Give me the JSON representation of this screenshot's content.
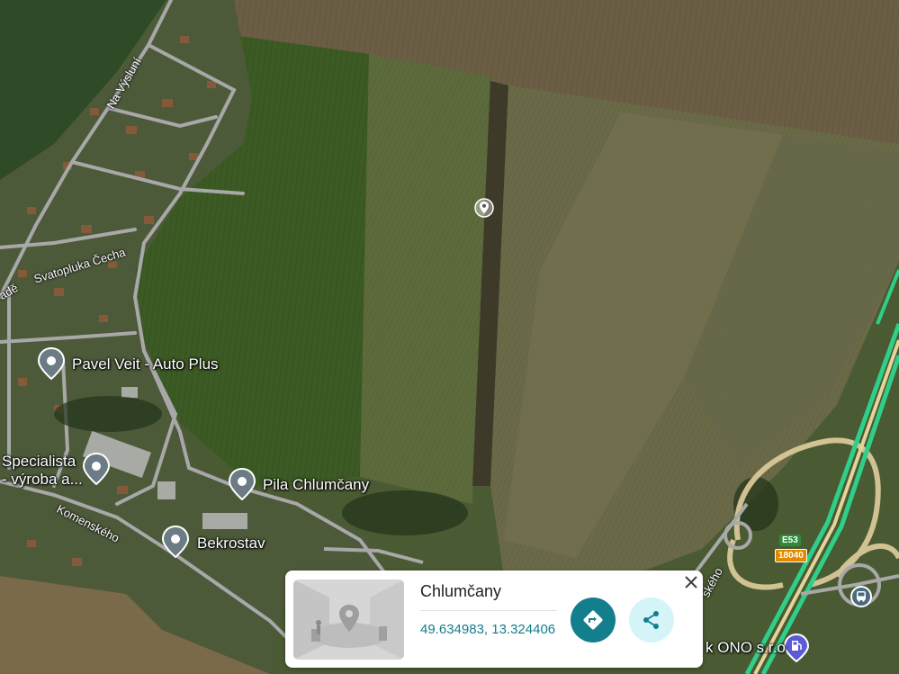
{
  "places": [
    {
      "name": "Pavel Veit - Auto Plus"
    },
    {
      "name": "Specialista\n- výroba a..."
    },
    {
      "name": "Pila Chlumčany"
    },
    {
      "name": "Bekrostav"
    },
    {
      "name": "k ONO s.r.o"
    }
  ],
  "streets": [
    "Na Výsluní",
    "Svatopluka Čecha",
    "adě",
    "Komenského",
    "ského"
  ],
  "road_shields": {
    "e_route": "E53",
    "road_number": "18040"
  },
  "info_card": {
    "title": "Chlumčany",
    "coordinates": "49.634983, 13.324406",
    "directions_icon": "directions-icon",
    "share_icon": "share-icon",
    "close_icon": "close-icon"
  },
  "colors": {
    "accent": "#137e8c",
    "share_bg": "#d4f4f8",
    "highway": "#34d399",
    "e_shield": "#2e8b3a",
    "route_shield": "#e08a00"
  }
}
